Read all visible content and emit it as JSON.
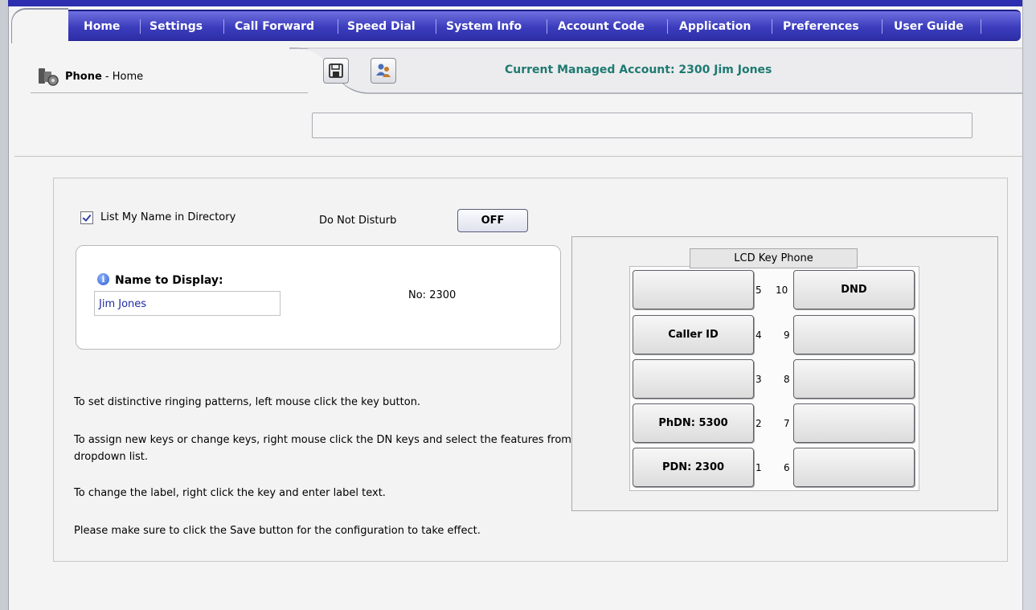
{
  "nav": {
    "items": [
      "Home",
      "Settings",
      "Call Forward",
      "Speed Dial",
      "System Info",
      "Account Code",
      "Application",
      "Preferences",
      "User Guide"
    ]
  },
  "header": {
    "title_bold": "Phone",
    "title_rest": " - Home",
    "account_label": "Current Managed Account:  2300  Jim Jones",
    "save_icon": "save-icon",
    "user_icon": "user-icon"
  },
  "settings": {
    "list_name_label": "List My Name in Directory",
    "list_name_checked": true,
    "dnd_label": "Do Not Disturb",
    "dnd_value": "OFF",
    "name_label": "Name to Display:",
    "name_value": "Jim Jones",
    "number": "No: 2300"
  },
  "instructions": [
    "To set distinctive ringing patterns, left mouse click the key button.",
    "To assign new keys or change keys, right mouse click the DN keys and select the features from dropdown list.",
    "To change the label, right click the key and enter label text.",
    "Please make sure to click the Save button for the configuration to take effect."
  ],
  "phone": {
    "title": "LCD Key Phone",
    "left_keys": [
      {
        "num": "5",
        "label": ""
      },
      {
        "num": "4",
        "label": "Caller ID"
      },
      {
        "num": "3",
        "label": ""
      },
      {
        "num": "2",
        "label": "PhDN: 5300"
      },
      {
        "num": "1",
        "label": "PDN: 2300"
      }
    ],
    "right_keys": [
      {
        "num": "10",
        "label": "DND"
      },
      {
        "num": "9",
        "label": ""
      },
      {
        "num": "8",
        "label": ""
      },
      {
        "num": "7",
        "label": ""
      },
      {
        "num": "6",
        "label": ""
      }
    ]
  },
  "colors": {
    "nav_bg": "#3c3dbd",
    "account_text": "#1e7a72",
    "name_input_text": "#1d2aa6"
  }
}
